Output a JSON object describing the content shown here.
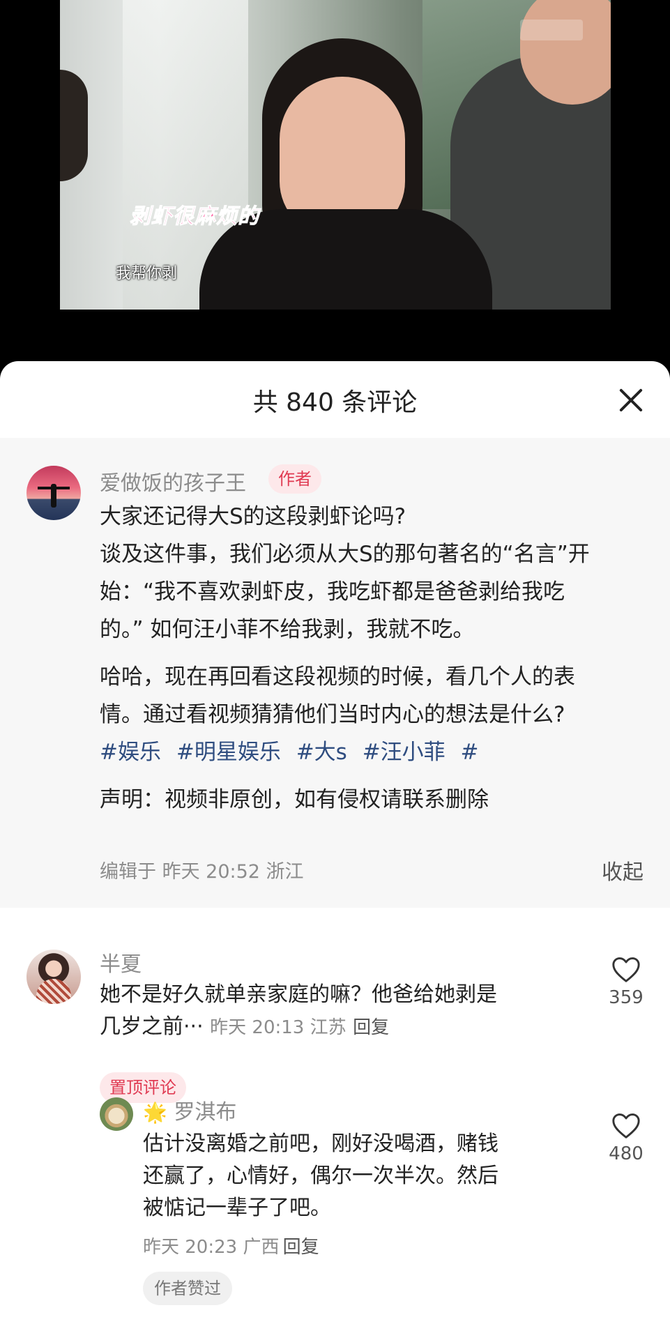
{
  "video": {
    "subtitle_pink": "剥虾很麻烦的",
    "subtitle_white": "我帮你剥"
  },
  "sheet": {
    "title": "共 840 条评论",
    "close_icon": "close-icon"
  },
  "post": {
    "author_name": "爱做饭的孩子王",
    "author_badge": "作者",
    "paragraph1_line1": "大家还记得大S的这段剥虾论吗?",
    "paragraph1_line2": "谈及这件事，我们必须从大S的那句著名的“名言”开",
    "paragraph1_line3": "始：“我不喜欢剥虾皮，我吃虾都是爸爸剥给我吃",
    "paragraph1_line4": "的。” 如何汪小菲不给我剥，我就不吃。",
    "paragraph2_line1": "哈哈，现在再回看这段视频的时候，看几个人的表",
    "paragraph2_line2": "情。通过看视频猜猜他们当时内心的想法是什么?",
    "tags": [
      "#娱乐",
      "#明星娱乐",
      "#大s",
      "#汪小菲",
      "#"
    ],
    "disclaimer": "声明：视频非原创，如有侵权请联系删除",
    "meta": "编辑于 昨天 20:52 浙江",
    "collapse": "收起"
  },
  "comments": [
    {
      "name": "半夏",
      "text_line1": "她不是好久就单亲家庭的嘛？他爸给她剥是",
      "text_line2": "几岁之前···",
      "meta": "昨天 20:13 江苏",
      "reply": "回复",
      "badge": "置顶评论",
      "likes": "359"
    },
    {
      "name": "罗淇布",
      "prefix_icon": "sparkle-icon",
      "text_line1": "估计没离婚之前吧，刚好没喝酒，赌钱",
      "text_line2": "还赢了，心情好，偶尔一次半次。然后",
      "text_line3": "被惦记一辈子了吧。",
      "meta": "昨天 20:23 广西",
      "reply": "回复",
      "likes": "480",
      "author_liked": "作者赞过"
    }
  ]
}
